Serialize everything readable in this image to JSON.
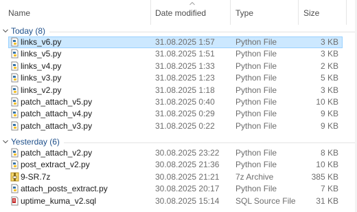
{
  "columns": {
    "name": "Name",
    "date": "Date modified",
    "type": "Type",
    "size": "Size"
  },
  "groups": [
    {
      "label": "Today (8)",
      "rows": [
        {
          "name": "links_v6.py",
          "date": "31.08.2025 1:57",
          "type": "Python File",
          "size": "3 KB",
          "icon": "python-file-icon",
          "selected": true
        },
        {
          "name": "links_v5.py",
          "date": "31.08.2025 1:51",
          "type": "Python File",
          "size": "3 KB",
          "icon": "python-file-icon"
        },
        {
          "name": "links_v4.py",
          "date": "31.08.2025 1:33",
          "type": "Python File",
          "size": "2 KB",
          "icon": "python-file-icon"
        },
        {
          "name": "links_v3.py",
          "date": "31.08.2025 1:23",
          "type": "Python File",
          "size": "5 KB",
          "icon": "python-file-icon"
        },
        {
          "name": "links_v2.py",
          "date": "31.08.2025 1:18",
          "type": "Python File",
          "size": "3 KB",
          "icon": "python-file-icon"
        },
        {
          "name": "patch_attach_v5.py",
          "date": "31.08.2025 0:40",
          "type": "Python File",
          "size": "10 KB",
          "icon": "python-file-icon"
        },
        {
          "name": "patch_attach_v4.py",
          "date": "31.08.2025 0:29",
          "type": "Python File",
          "size": "9 KB",
          "icon": "python-file-icon"
        },
        {
          "name": "patch_attach_v3.py",
          "date": "31.08.2025 0:22",
          "type": "Python File",
          "size": "9 KB",
          "icon": "python-file-icon"
        }
      ]
    },
    {
      "label": "Yesterday (6)",
      "rows": [
        {
          "name": "patch_attach_v2.py",
          "date": "30.08.2025 23:22",
          "type": "Python File",
          "size": "8 KB",
          "icon": "python-file-icon"
        },
        {
          "name": "post_extract_v2.py",
          "date": "30.08.2025 21:36",
          "type": "Python File",
          "size": "10 KB",
          "icon": "python-file-icon"
        },
        {
          "name": "9-SR.7z",
          "date": "30.08.2025 21:21",
          "type": "7z Archive",
          "size": "385 KB",
          "icon": "archive-file-icon"
        },
        {
          "name": "attach_posts_extract.py",
          "date": "30.08.2025 20:17",
          "type": "Python File",
          "size": "7 KB",
          "icon": "python-file-icon"
        },
        {
          "name": "uptime_kuma_v2.sql",
          "date": "30.08.2025 15:14",
          "type": "SQL Source File",
          "size": "31 KB",
          "icon": "sql-file-icon"
        }
      ]
    }
  ],
  "colors": {
    "selection_bg": "#cce8ff",
    "selection_border": "#99d1ff",
    "group_label": "#1e4f8a"
  }
}
